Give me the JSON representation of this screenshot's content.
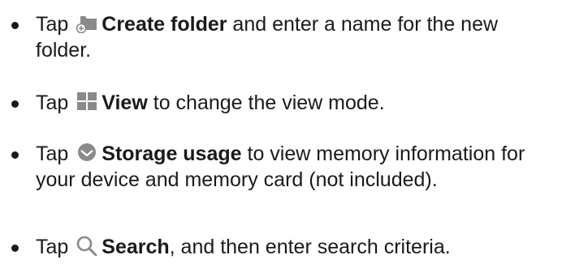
{
  "items": [
    {
      "tap": "Tap",
      "icon": "create-folder-icon",
      "term": "Create folder",
      "rest": " and enter a name for the new folder."
    },
    {
      "tap": "Tap",
      "icon": "view-grid-icon",
      "term": "View",
      "rest": " to change the view mode."
    },
    {
      "tap": "Tap",
      "icon": "storage-usage-icon",
      "term": "Storage usage",
      "rest": " to view memory information for your device and memory card (not included)."
    },
    {
      "tap": "Tap",
      "icon": "search-icon",
      "term": "Search",
      "rest": ", and then enter search criteria."
    }
  ],
  "colors": {
    "icon_gray": "#8a8a8a",
    "text": "#1a1a1a"
  }
}
